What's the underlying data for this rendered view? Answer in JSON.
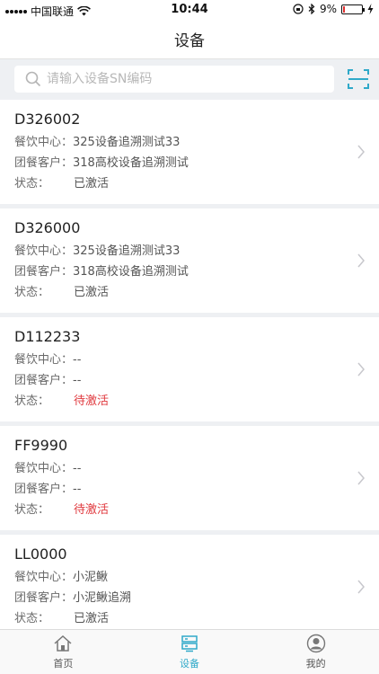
{
  "status_bar": {
    "carrier": "中国联通",
    "time": "10:44",
    "battery": "9%",
    "battery_level": 0.09
  },
  "header": {
    "title": "设备"
  },
  "search": {
    "placeholder": "请输入设备SN编码"
  },
  "labels": {
    "center": "餐饮中心：",
    "customer": "团餐客户：",
    "status": "状态："
  },
  "devices": [
    {
      "sn": "D326002",
      "center": "325设备追溯测试33",
      "customer": "318高校设备追溯测试",
      "status": "已激活"
    },
    {
      "sn": "D326000",
      "center": "325设备追溯测试33",
      "customer": "318高校设备追溯测试",
      "status": "已激活"
    },
    {
      "sn": "D112233",
      "center": "--",
      "customer": "--",
      "status": "待激活"
    },
    {
      "sn": "FF9990",
      "center": "--",
      "customer": "--",
      "status": "待激活"
    },
    {
      "sn": "LL0000",
      "center": "小泥鳅",
      "customer": "小泥鳅追溯",
      "status": "已激活"
    }
  ],
  "tabs": {
    "home": "首页",
    "devices": "设备",
    "mine": "我的"
  },
  "colors": {
    "accent": "#2fa9c9",
    "inactive_status": "#e0393e"
  }
}
